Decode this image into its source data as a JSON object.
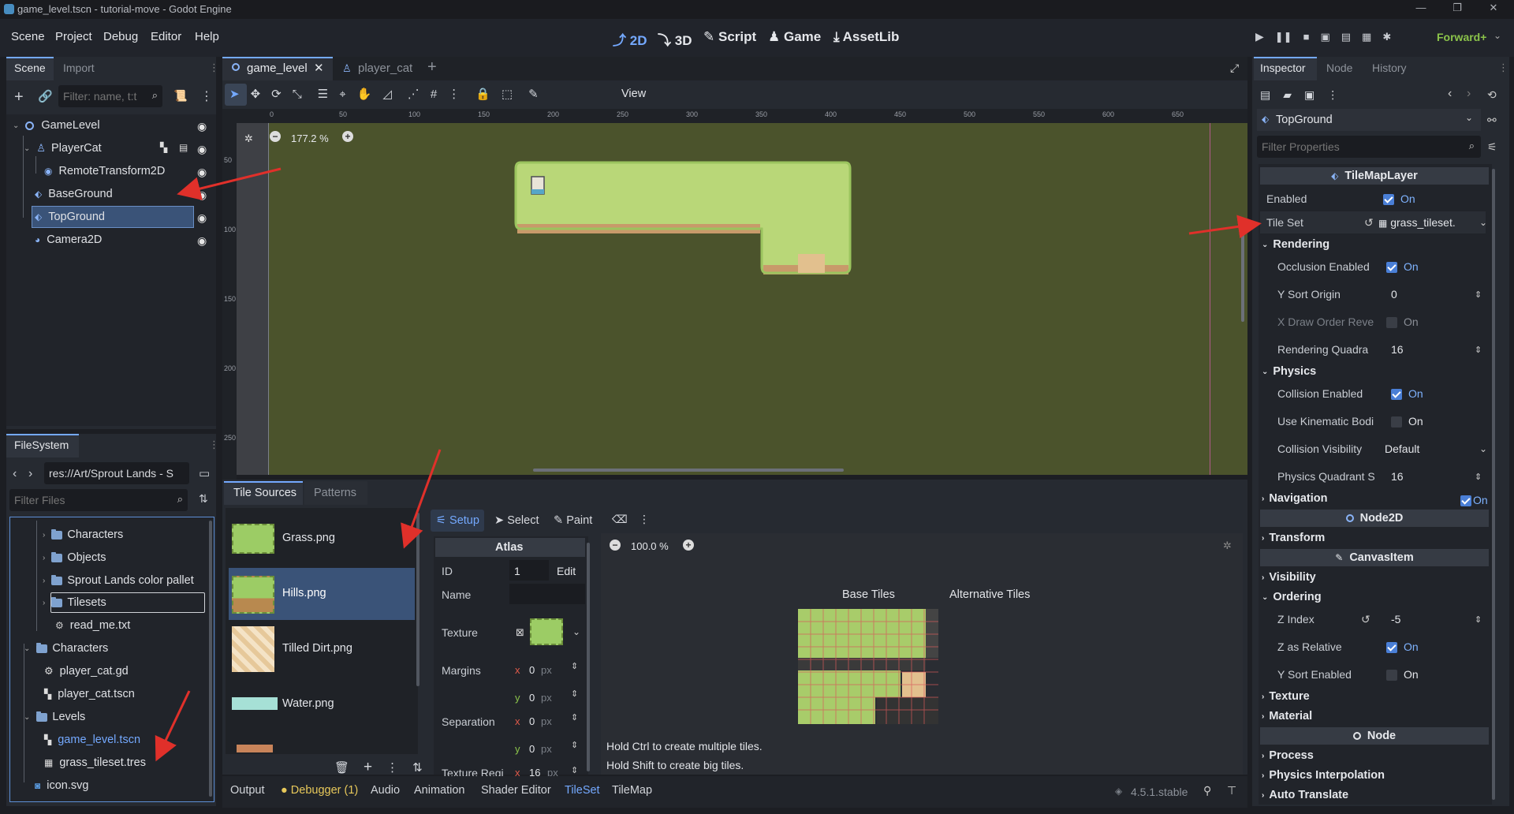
{
  "window": {
    "title": "game_level.tscn - tutorial-move - Godot Engine"
  },
  "menu": {
    "items": [
      "Scene",
      "Project",
      "Debug",
      "Editor",
      "Help"
    ]
  },
  "workspaces": [
    "2D",
    "3D",
    "Script",
    "Game",
    "AssetLib"
  ],
  "renderer": "Forward+",
  "scene_dock": {
    "tabs": [
      "Scene",
      "Import"
    ],
    "filter_placeholder": "Filter: name, t:t",
    "nodes": [
      {
        "label": "GameLevel",
        "icon": "node2d-icon"
      },
      {
        "label": "PlayerCat",
        "icon": "character-icon"
      },
      {
        "label": "RemoteTransform2D",
        "icon": "remote-transform-icon"
      },
      {
        "label": "BaseGround",
        "icon": "tilemap-layer-icon"
      },
      {
        "label": "TopGround",
        "icon": "tilemap-layer-icon",
        "selected": true
      },
      {
        "label": "Camera2D",
        "icon": "camera-icon"
      }
    ]
  },
  "filesystem": {
    "title": "FileSystem",
    "path": "res://Art/Sprout Lands - S",
    "filter_placeholder": "Filter Files",
    "items": [
      {
        "label": "Characters",
        "type": "folder",
        "depth": 2
      },
      {
        "label": "Objects",
        "type": "folder",
        "depth": 2
      },
      {
        "label": "Sprout Lands color pallet",
        "type": "folder",
        "depth": 2
      },
      {
        "label": "Tilesets",
        "type": "folder",
        "depth": 2,
        "selected": true
      },
      {
        "label": "read_me.txt",
        "type": "file",
        "depth": 2
      },
      {
        "label": "Characters",
        "type": "folder",
        "depth": 1
      },
      {
        "label": "player_cat.gd",
        "type": "script",
        "depth": 2
      },
      {
        "label": "player_cat.tscn",
        "type": "scene",
        "depth": 2
      },
      {
        "label": "Levels",
        "type": "folder",
        "depth": 1
      },
      {
        "label": "game_level.tscn",
        "type": "scene",
        "depth": 2,
        "active": true
      },
      {
        "label": "grass_tileset.tres",
        "type": "resource",
        "depth": 2
      },
      {
        "label": "icon.svg",
        "type": "image",
        "depth": 1
      }
    ]
  },
  "editor_tabs": [
    "game_level",
    "player_cat"
  ],
  "toolbar": {
    "view_label": "View"
  },
  "viewport": {
    "zoom": "177.2 %",
    "ruler_x": [
      "0",
      "50",
      "100",
      "150",
      "200",
      "250",
      "300",
      "350",
      "400",
      "450",
      "500",
      "550",
      "600",
      "650"
    ],
    "ruler_y": [
      "50",
      "100",
      "150",
      "200",
      "250"
    ]
  },
  "tileset_panel": {
    "tabs": [
      "Tile Sources",
      "Patterns"
    ],
    "sources": [
      "Grass.png",
      "Hills.png",
      "Tilled Dirt.png",
      "Water.png"
    ],
    "modes": [
      "Setup",
      "Select",
      "Paint"
    ],
    "atlas": {
      "header": "Atlas",
      "id_label": "ID",
      "id_value": "1",
      "edit_label": "Edit",
      "name_label": "Name",
      "texture_label": "Texture",
      "margins_label": "Margins",
      "separation_label": "Separation",
      "texture_region_label": "Texture Regi",
      "x": "x",
      "y": "y",
      "zero": "0",
      "px": "px",
      "sixteen": "16"
    },
    "zoom": "100.0 %",
    "base_tiles": "Base Tiles",
    "alt_tiles": "Alternative Tiles",
    "hint1": "Hold Ctrl to create multiple tiles.",
    "hint2": "Hold Shift to create big tiles."
  },
  "bottom_bar": {
    "tabs": [
      "Output",
      "Debugger (1)",
      "Audio",
      "Animation",
      "Shader Editor",
      "TileSet",
      "TileMap"
    ],
    "version": "4.5.1.stable"
  },
  "inspector": {
    "tabs": [
      "Inspector",
      "Node",
      "History"
    ],
    "node_name": "TopGround",
    "filter_placeholder": "Filter Properties",
    "class_header": "TileMapLayer",
    "enabled": {
      "label": "Enabled",
      "value": "On"
    },
    "tileset": {
      "label": "Tile Set",
      "value": "grass_tileset."
    },
    "rendering": "Rendering",
    "occlusion": {
      "label": "Occlusion Enabled",
      "value": "On"
    },
    "ysort_origin": {
      "label": "Y Sort Origin",
      "value": "0"
    },
    "xdraw": {
      "label": "X Draw Order Reve",
      "value": "On"
    },
    "rquad": {
      "label": "Rendering Quadra",
      "value": "16"
    },
    "physics": "Physics",
    "collision": {
      "label": "Collision Enabled",
      "value": "On"
    },
    "kinematic": {
      "label": "Use Kinematic Bodi",
      "value": "On"
    },
    "col_vis": {
      "label": "Collision Visibility",
      "value": "Default"
    },
    "pquad": {
      "label": "Physics Quadrant S",
      "value": "16"
    },
    "navigation": {
      "label": "Navigation",
      "value": "On"
    },
    "node2d": "Node2D",
    "transform": "Transform",
    "canvasitem": "CanvasItem",
    "visibility": "Visibility",
    "ordering": "Ordering",
    "zindex": {
      "label": "Z Index",
      "value": "-5"
    },
    "zrel": {
      "label": "Z as Relative",
      "value": "On"
    },
    "ysort": {
      "label": "Y Sort Enabled",
      "value": "On"
    },
    "texture": "Texture",
    "material": "Material",
    "node": "Node",
    "process": "Process",
    "phys_interp": "Physics Interpolation",
    "auto_translate": "Auto Translate"
  },
  "colors": {
    "accent": "#74a9ff",
    "annotation_arrow": "#e0302a",
    "canvas_bg": "#4b532c"
  }
}
